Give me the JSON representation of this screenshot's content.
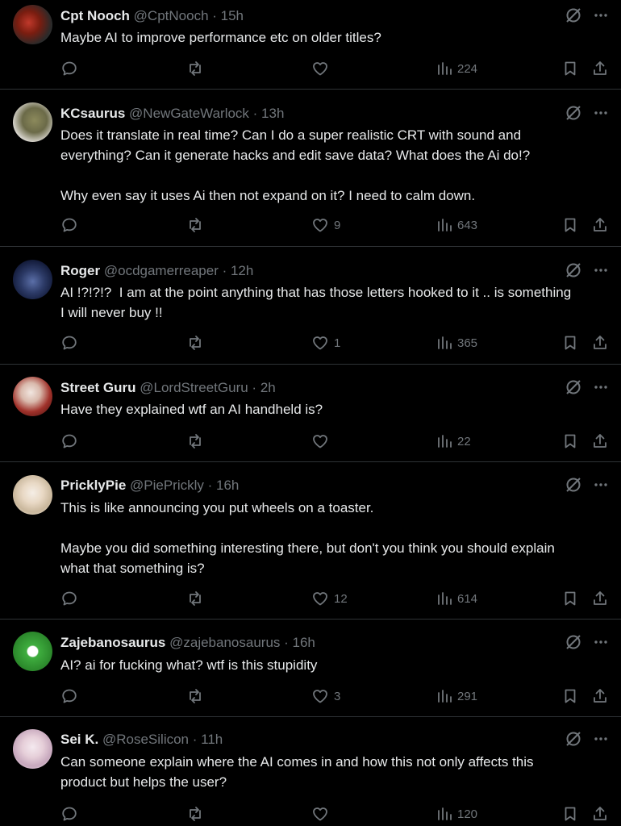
{
  "colors": {
    "background": "#000000",
    "text": "#e7e9ea",
    "muted": "#71767b",
    "divider": "#2f3336"
  },
  "icons": {
    "reply": "reply-icon",
    "repost": "repost-icon",
    "like": "heart-icon",
    "views": "views-icon",
    "bookmark": "bookmark-icon",
    "share": "share-icon",
    "grok": "grok-icon",
    "more": "more-icon"
  },
  "tweets": [
    {
      "name": "Cpt Nooch",
      "handle": "@CptNooch",
      "time": "15h",
      "text": "Maybe AI to improve performance etc on older titles?",
      "likes": "",
      "views": "224"
    },
    {
      "name": "KCsaurus",
      "handle": "@NewGateWarlock",
      "time": "13h",
      "text": "Does it translate in real time? Can I do a super realistic CRT with sound and\neverything? Can it generate hacks and edit save data? What does the Ai do!?\n\nWhy even say it uses Ai then not expand on it? I need to calm down.",
      "likes": "9",
      "views": "643"
    },
    {
      "name": "Roger",
      "handle": "@ocdgamerreaper",
      "time": "12h",
      "text": "AI !?!?!?  I am at the point anything that has those letters hooked to it .. is something\nI will never buy !!",
      "likes": "1",
      "views": "365"
    },
    {
      "name": "Street Guru",
      "handle": "@LordStreetGuru",
      "time": "2h",
      "text": "Have they explained wtf an AI handheld is?",
      "likes": "",
      "views": "22"
    },
    {
      "name": "PricklyPie",
      "handle": "@PiePrickly",
      "time": "16h",
      "text": "This is like announcing you put wheels on a toaster.\n\nMaybe you did something interesting there, but don't you think you should explain\nwhat that something is?",
      "likes": "12",
      "views": "614"
    },
    {
      "name": "Zajebanosaurus",
      "handle": "@zajebanosaurus",
      "time": "16h",
      "text": "AI? ai for fucking what? wtf is this stupidity",
      "likes": "3",
      "views": "291"
    },
    {
      "name": "Sei K.",
      "handle": "@RoseSilicon",
      "time": "11h",
      "text": "Can someone explain where the AI comes in and how this not only affects this\nproduct but helps the user?",
      "likes": "",
      "views": "120"
    }
  ]
}
